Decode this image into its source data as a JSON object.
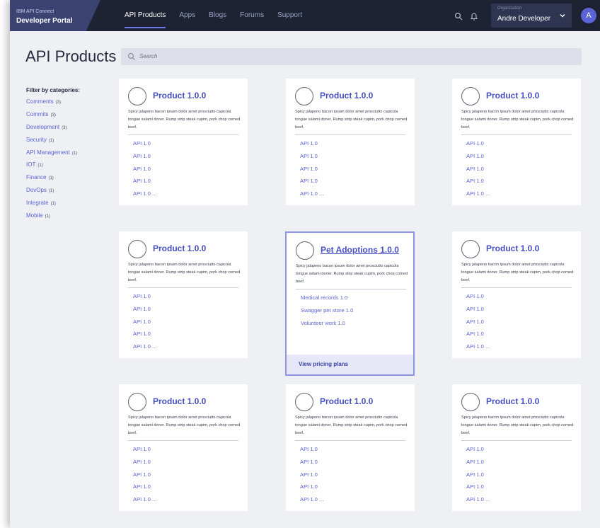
{
  "nav": {
    "brand_sub": "IBM API Connect",
    "brand_main": "Developer Portal",
    "links": [
      "API Products",
      "Apps",
      "Blogs",
      "Forums",
      "Support"
    ],
    "org_label": "Organization",
    "org_name": "Andre Developer",
    "avatar_initial": "A"
  },
  "page": {
    "title": "API Products",
    "search_placeholder": "Search"
  },
  "sidebar": {
    "header": "Filter by categories:",
    "items": [
      {
        "label": "Comments",
        "count": "(3)"
      },
      {
        "label": "Commits",
        "count": "(3)"
      },
      {
        "label": "Development",
        "count": "(3)"
      },
      {
        "label": "Security",
        "count": "(1)"
      },
      {
        "label": "API Management",
        "count": "(1)"
      },
      {
        "label": "IOT",
        "count": "(1)"
      },
      {
        "label": "Finance",
        "count": "(1)"
      },
      {
        "label": "DevOps",
        "count": "(1)"
      },
      {
        "label": "Integrate",
        "count": "(1)"
      },
      {
        "label": "Mobile",
        "count": "(1)"
      }
    ]
  },
  "products": [
    {
      "title": "Product 1.0.0",
      "desc": "Spicy jalapeno bacon ipsum dolor amet prosciutto capicola tongue salami doner. Rump strip steak cupim, pork chop corned beef.",
      "apis": [
        "API 1.0",
        "API 1.0",
        "API 1.0",
        "API 1.0",
        "API 1.0 ..."
      ]
    },
    {
      "title": "Product 1.0.0",
      "desc": "Spicy jalapeno bacon ipsum dolor amet prosciutto capicola tongue salami doner. Rump strip steak cupim, pork chop corned beef.",
      "apis": [
        "API 1.0",
        "API 1.0",
        "API 1.0",
        "API 1.0",
        "API 1.0 ..."
      ]
    },
    {
      "title": "Product 1.0.0",
      "desc": "Spicy jalapeno bacon ipsum dolor amet prosciutto capicola tongue salami doner. Rump strip steak cupim, pork chop corned beef.",
      "apis": [
        "API 1.0",
        "API 1.0",
        "API 1.0",
        "API 1.0",
        "API 1.0 ..."
      ]
    },
    {
      "title": "Product 1.0.0",
      "desc": "Spicy jalapeno bacon ipsum dolor amet prosciutto capicola tongue salami doner. Rump strip steak cupim, pork chop corned beef.",
      "apis": [
        "API 1.0",
        "API 1.0",
        "API 1.0",
        "API 1.0",
        "API 1.0 ..."
      ]
    },
    {
      "title": "Pet Adoptions 1.0.0",
      "desc": "Spicy jalapeno bacon ipsum dolor amet prosciutto capicola tongue salami doner. Rump strip steak cupim, pork chop corned beef.",
      "apis": [
        "Medical records 1.0",
        "Swagger pet store 1.0",
        "Volunteer work 1.0"
      ],
      "selected": true,
      "pricing": "View pricing plans"
    },
    {
      "title": "Product 1.0.0",
      "desc": "Spicy jalapeno bacon ipsum dolor amet prosciutto capicola tongue salami doner. Rump strip steak cupim, pork chop corned beef.",
      "apis": [
        "API 1.0",
        "API 1.0",
        "API 1.0",
        "API 1.0",
        "API 1.0 ..."
      ]
    },
    {
      "title": "Product 1.0.0",
      "desc": "Spicy jalapeno bacon ipsum dolor amet prosciutto capicola tongue salami doner. Rump strip steak cupim, pork chop corned beef.",
      "apis": [
        "API 1.0",
        "API 1.0",
        "API 1.0",
        "API 1.0",
        "API 1.0 ..."
      ]
    },
    {
      "title": "Product 1.0.0",
      "desc": "Spicy jalapeno bacon ipsum dolor amet prosciutto capicola tongue salami doner. Rump strip steak cupim, pork chop corned beef.",
      "apis": [
        "API 1.0",
        "API 1.0",
        "API 1.0",
        "API 1.0",
        "API 1.0 ..."
      ]
    },
    {
      "title": "Product 1.0.0",
      "desc": "Spicy jalapeno bacon ipsum dolor amet prosciutto capicola tongue salami doner. Rump strip steak cupim, pork chop corned beef.",
      "apis": [
        "API 1.0",
        "API 1.0",
        "API 1.0",
        "API 1.0",
        "API 1.0 ..."
      ]
    }
  ],
  "colors": {
    "nav_bg": "#1e2333",
    "brand_bg": "#3b4372",
    "accent": "#5b64d4",
    "title_link": "#4750c0",
    "page_bg": "#eef0f4",
    "selected_border": "#8d95e6"
  },
  "icons": {
    "search": "search-icon",
    "bell": "bell-icon",
    "chevron": "chevron-down-icon"
  }
}
